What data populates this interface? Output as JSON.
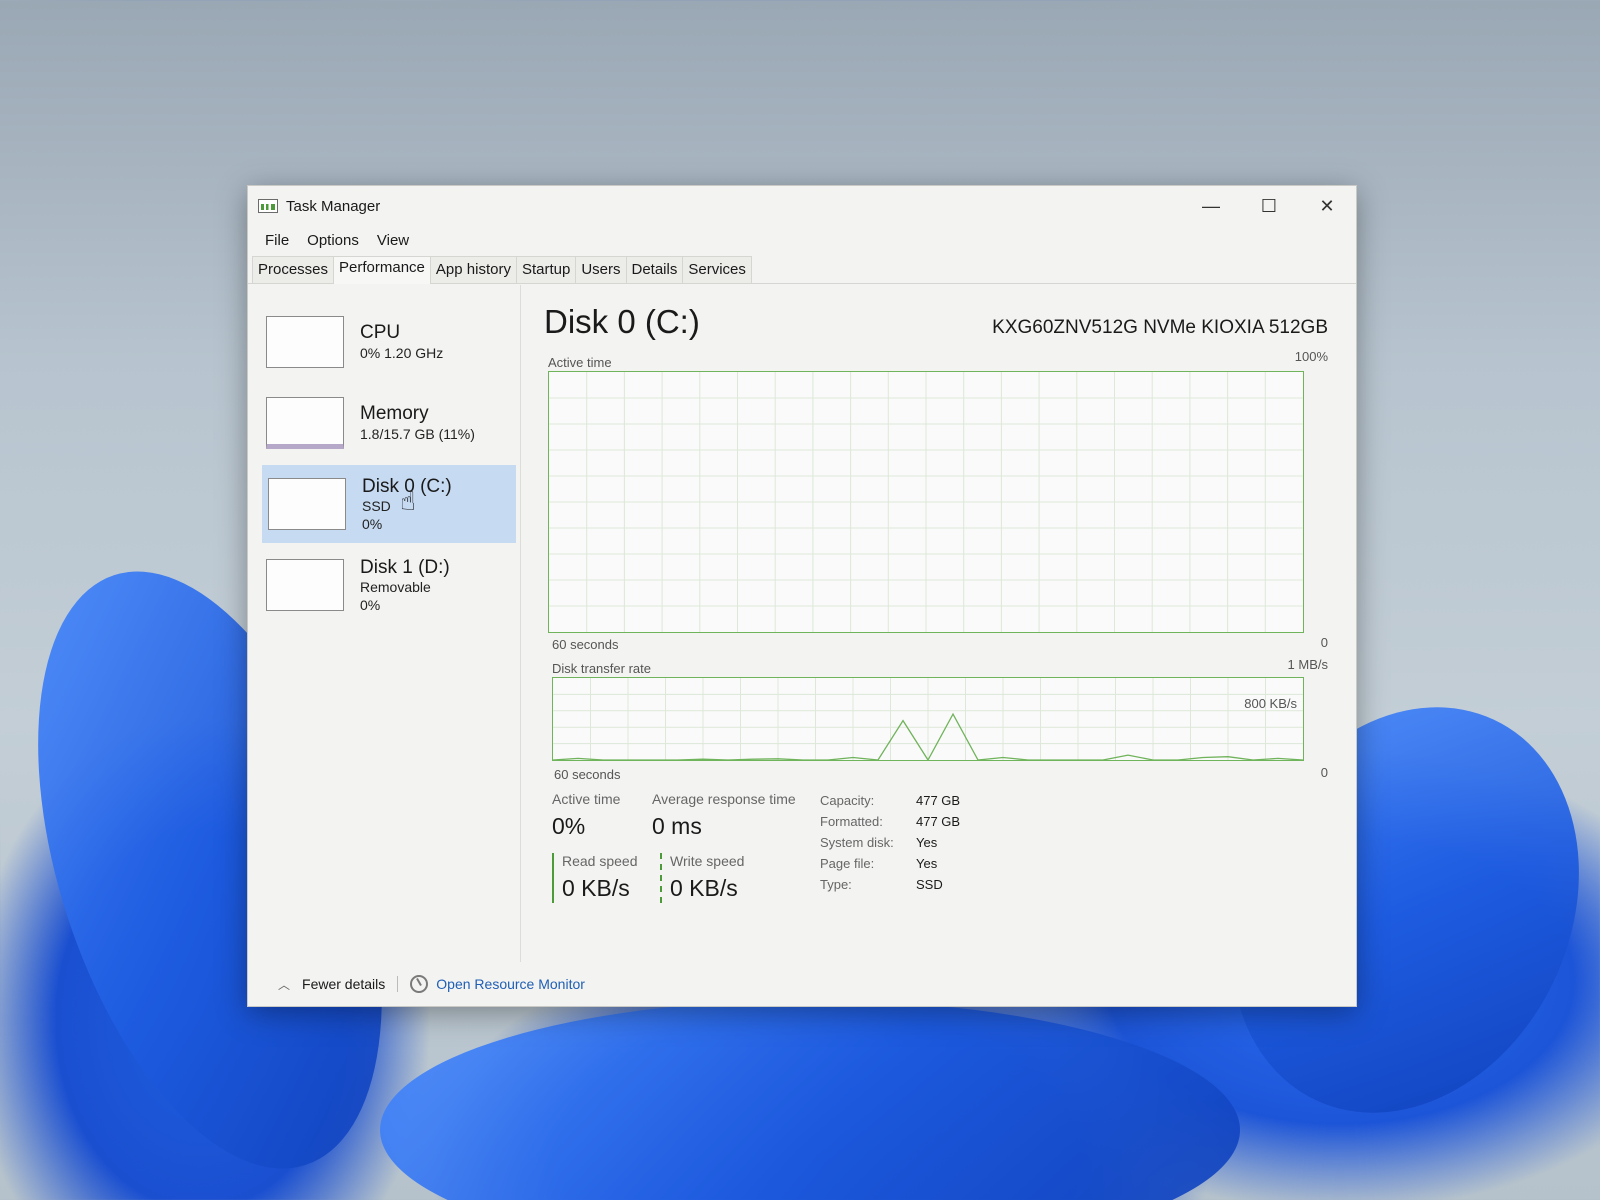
{
  "window": {
    "title": "Task Manager",
    "controls": {
      "minimize": "—",
      "maximize": "☐",
      "close": "✕"
    }
  },
  "menu": [
    "File",
    "Options",
    "View"
  ],
  "tabs": [
    "Processes",
    "Performance",
    "App history",
    "Startup",
    "Users",
    "Details",
    "Services"
  ],
  "active_tab": "Performance",
  "sidebar": [
    {
      "title": "CPU",
      "lines": [
        "0%  1.20 GHz"
      ],
      "selected": false
    },
    {
      "title": "Memory",
      "lines": [
        "1.8/15.7 GB (11%)"
      ],
      "selected": false
    },
    {
      "title": "Disk 0 (C:)",
      "lines": [
        "SSD",
        "0%"
      ],
      "selected": true
    },
    {
      "title": "Disk 1 (D:)",
      "lines": [
        "Removable",
        "0%"
      ],
      "selected": false
    }
  ],
  "main": {
    "title": "Disk 0 (C:)",
    "model": "KXG60ZNV512G NVMe KIOXIA 512GB",
    "active_graph": {
      "label": "Active time",
      "max": "100%",
      "time_label": "60 seconds",
      "min": "0"
    },
    "transfer_graph": {
      "label": "Disk transfer rate",
      "max": "1 MB/s",
      "mid": "800 KB/s",
      "time_label": "60 seconds",
      "min": "0"
    }
  },
  "stats": {
    "active_time": {
      "label": "Active time",
      "value": "0%"
    },
    "avg_response": {
      "label": "Average response time",
      "value": "0 ms"
    },
    "read_speed": {
      "label": "Read speed",
      "value": "0 KB/s"
    },
    "write_speed": {
      "label": "Write speed",
      "value": "0 KB/s"
    }
  },
  "properties": [
    {
      "key": "Capacity:",
      "value": "477 GB"
    },
    {
      "key": "Formatted:",
      "value": "477 GB"
    },
    {
      "key": "System disk:",
      "value": "Yes"
    },
    {
      "key": "Page file:",
      "value": "Yes"
    },
    {
      "key": "Type:",
      "value": "SSD"
    }
  ],
  "footer": {
    "fewer_details": "Fewer details",
    "open_resource_monitor": "Open Resource Monitor"
  },
  "colors": {
    "graph_line": "#6fb35a",
    "selected_bg": "#c6daf2",
    "link": "#1f5fb5"
  },
  "chart_data": {
    "type": "line",
    "title": "Disk transfer rate",
    "x": [
      0,
      2,
      4,
      6,
      8,
      10,
      12,
      14,
      16,
      18,
      20,
      22,
      24,
      26,
      28,
      30,
      32,
      34,
      36,
      38,
      40,
      42,
      44,
      46,
      48,
      50,
      52,
      54,
      56,
      58,
      60
    ],
    "series": [
      {
        "values": [
          0,
          20,
          0,
          0,
          0,
          0,
          10,
          0,
          10,
          15,
          0,
          0,
          30,
          0,
          480,
          0,
          560,
          0,
          30,
          0,
          0,
          0,
          0,
          60,
          0,
          0,
          30,
          40,
          0,
          20,
          0
        ]
      }
    ],
    "ylabel": "",
    "xlabel": "60 seconds",
    "ylim": [
      0,
      1000
    ],
    "grid": true
  }
}
